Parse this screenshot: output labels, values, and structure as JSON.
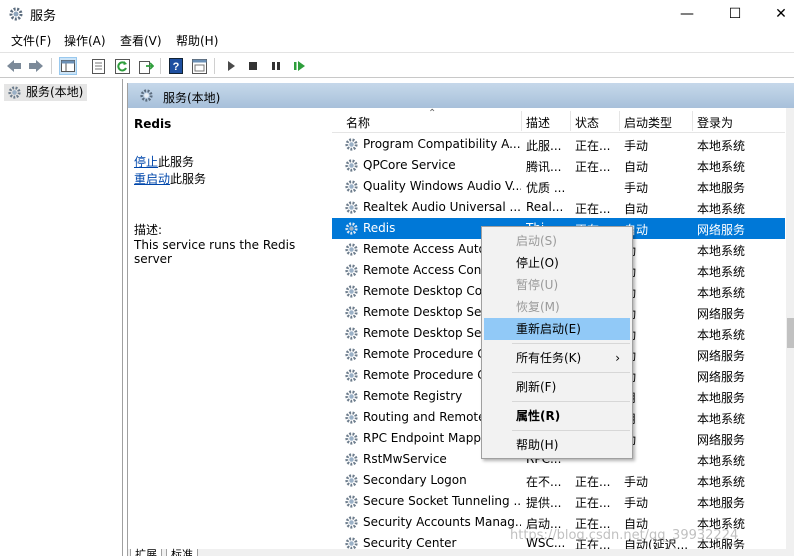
{
  "window": {
    "title": "服务",
    "minimize": "—",
    "maximize": "☐",
    "close": "✕"
  },
  "menu": [
    "文件(F)",
    "操作(A)",
    "查看(V)",
    "帮助(H)"
  ],
  "toolbar": {
    "icons": [
      "back-arrow-icon",
      "forward-arrow-icon",
      "console-tree-icon",
      "properties-sheet-icon",
      "refresh-icon",
      "export-list-icon",
      "help-icon",
      "mmc-view-icon",
      "start-service-icon",
      "stop-service-icon",
      "pause-service-icon",
      "restart-service-icon"
    ]
  },
  "tree": {
    "item": "服务(本地)"
  },
  "main_header": {
    "title": "服务(本地)"
  },
  "detail": {
    "service_name": "Redis",
    "stop_link": "停止",
    "stop_suffix": "此服务",
    "restart_link": "重启动",
    "restart_suffix": "此服务",
    "desc_label": "描述:",
    "desc_text": "This service runs the Redis server"
  },
  "columns": [
    "名称",
    "描述",
    "状态",
    "启动类型",
    "登录为"
  ],
  "rows": [
    {
      "name": "Program Compatibility A...",
      "desc": "此服...",
      "status": "正在...",
      "startup": "手动",
      "logon": "本地系统"
    },
    {
      "name": "QPCore Service",
      "desc": "腾讯...",
      "status": "正在...",
      "startup": "自动",
      "logon": "本地系统"
    },
    {
      "name": "Quality Windows Audio V...",
      "desc": "优质 ...",
      "status": "",
      "startup": "手动",
      "logon": "本地服务"
    },
    {
      "name": "Realtek Audio Universal ...",
      "desc": "Real...",
      "status": "正在...",
      "startup": "自动",
      "logon": "本地系统"
    },
    {
      "name": "Redis",
      "desc": "Thi...",
      "status": "正在...",
      "startup": "自动",
      "logon": "网络服务"
    },
    {
      "name": "Remote Access Auto",
      "desc": "",
      "status": "",
      "startup": "动",
      "logon": "本地系统"
    },
    {
      "name": "Remote Access Conn",
      "desc": "",
      "status": "",
      "startup": "动",
      "logon": "本地系统"
    },
    {
      "name": "Remote Desktop Co",
      "desc": "",
      "status": "",
      "startup": "动",
      "logon": "本地系统"
    },
    {
      "name": "Remote Desktop Ser",
      "desc": "",
      "status": "",
      "startup": "动",
      "logon": "网络服务"
    },
    {
      "name": "Remote Desktop Ser",
      "desc": "",
      "status": "",
      "startup": "动",
      "logon": "本地系统"
    },
    {
      "name": "Remote Procedure C",
      "desc": "",
      "status": "",
      "startup": "动",
      "logon": "网络服务"
    },
    {
      "name": "Remote Procedure C",
      "desc": "",
      "status": "",
      "startup": "动",
      "logon": "网络服务"
    },
    {
      "name": "Remote Registry",
      "desc": "",
      "status": "",
      "startup": "用",
      "logon": "本地服务"
    },
    {
      "name": "Routing and Remote",
      "desc": "",
      "status": "",
      "startup": "用",
      "logon": "本地系统"
    },
    {
      "name": "RPC Endpoint Mapp",
      "desc": "",
      "status": "",
      "startup": "动",
      "logon": "网络服务"
    },
    {
      "name": "RstMwService",
      "desc": "RPC...",
      "status": "",
      "startup": "",
      "logon": "本地系统"
    },
    {
      "name": "Secondary Logon",
      "desc": "在不...",
      "status": "正在...",
      "startup": "手动",
      "logon": "本地系统"
    },
    {
      "name": "Secure Socket Tunneling ...",
      "desc": "提供...",
      "status": "正在...",
      "startup": "手动",
      "logon": "本地服务"
    },
    {
      "name": "Security Accounts Manag...",
      "desc": "启动...",
      "status": "正在...",
      "startup": "自动",
      "logon": "本地系统"
    },
    {
      "name": "Security Center",
      "desc": "WSC...",
      "status": "正在...",
      "startup": "自动(延迟...",
      "logon": "本地服务"
    }
  ],
  "context_menu": {
    "start": "启动(S)",
    "stop": "停止(O)",
    "pause": "暂停(U)",
    "resume": "恢复(M)",
    "restart": "重新启动(E)",
    "all_tasks": "所有任务(K)",
    "refresh": "刷新(F)",
    "properties": "属性(R)",
    "help": "帮助(H)"
  },
  "tabs": [
    "扩展",
    "标准"
  ],
  "watermark": "https://blog.csdn.net/qq_39932224",
  "colors": {
    "selection": "#0078d7",
    "menu_highlight": "#91c9f7",
    "header_gradient": "#a7c0da"
  }
}
